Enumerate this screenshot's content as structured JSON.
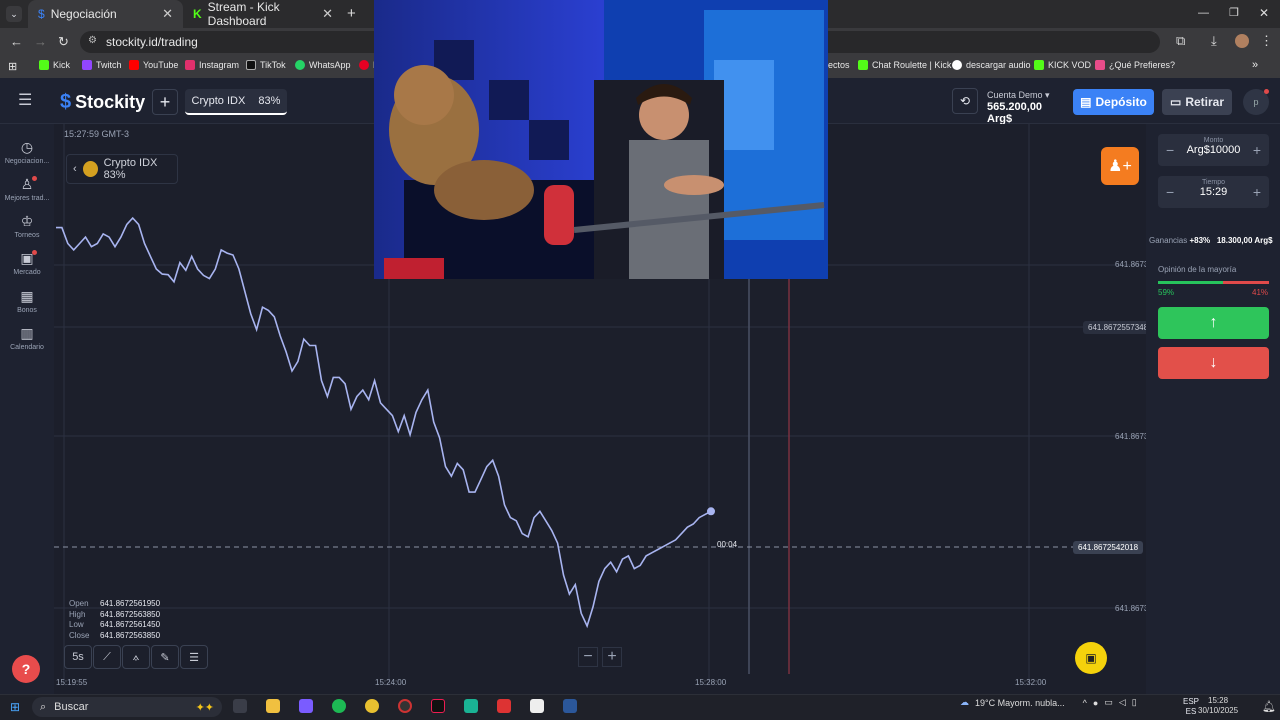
{
  "browser": {
    "tabs": [
      {
        "label": "Negociación"
      },
      {
        "label": "Stream - Kick Dashboard"
      }
    ],
    "url": "stockity.id/trading",
    "bookmarks": [
      {
        "label": "Kick",
        "color": "#53fc18"
      },
      {
        "label": "Twitch",
        "color": "#9146ff"
      },
      {
        "label": "YouTube",
        "color": "#ff0000"
      },
      {
        "label": "Instagram",
        "color": "#e1306c"
      },
      {
        "label": "TikTok",
        "color": "#111111"
      },
      {
        "label": "WhatsApp",
        "color": "#25d366"
      },
      {
        "label": "P",
        "color": "#e60023"
      },
      {
        "label": "ectos",
        "color": "#3a3a3d"
      },
      {
        "label": "Chat Roulette | Kick",
        "color": "#53fc18"
      },
      {
        "label": "descargar audio",
        "color": "#ffffff"
      },
      {
        "label": "KICK VOD",
        "color": "#53fc18"
      },
      {
        "label": "¿Qué Prefieres?",
        "color": "#e84c8a"
      }
    ]
  },
  "app": {
    "brand": "Stockity",
    "asset_tab": {
      "name": "Crypto IDX",
      "payout": "83%"
    },
    "account": {
      "type": "Cuenta Demo",
      "balance": "565.200,00 Arg$"
    },
    "deposit_label": "Depósito",
    "withdraw_label": "Retirar",
    "avatar_letter": "p"
  },
  "sidebar": [
    {
      "label": "Negociacion...",
      "icon": "clock-icon"
    },
    {
      "label": "Mejores trad...",
      "icon": "trophy-user-icon"
    },
    {
      "label": "Torneos",
      "icon": "cup-icon"
    },
    {
      "label": "Mercado",
      "icon": "bag-icon"
    },
    {
      "label": "Bonos",
      "icon": "gift-icon"
    },
    {
      "label": "Calendario",
      "icon": "calendar-icon"
    }
  ],
  "chart": {
    "timestamp": "15:27:59 GMT-3",
    "asset_pill": "Crypto IDX 83%",
    "ohlc": {
      "Open": "641.8672561950",
      "High": "641.8672563850",
      "Low": "641.8672561450",
      "Close": "641.8672563850"
    },
    "timeframe": "5s",
    "price_labels": [
      "641.8673",
      "641.8673",
      "641.8673"
    ],
    "hover_price": "641.8672557348",
    "current_price": "641.8672542018",
    "countdown": "00:04",
    "time_labels": [
      "15:19:55",
      "15:24:00",
      "15:28:00",
      "15:32:00"
    ]
  },
  "chart_data": {
    "type": "line",
    "series": [
      {
        "values": [
          641.86725715,
          641.86725715,
          641.8672569,
          641.8672568,
          641.8672569,
          641.867257,
          641.86725685,
          641.8672569,
          641.86725705,
          641.867257,
          641.86725685,
          641.867257,
          641.8672572,
          641.8672573,
          641.8672572,
          641.8672569,
          641.8672567,
          641.8672565,
          641.86725642,
          641.86725641,
          641.8672563,
          641.8672566,
          641.86725648,
          641.8672567,
          641.8672565,
          641.8672564,
          641.86725635,
          641.8672565,
          641.8672568,
          641.86725675,
          641.86725672,
          641.8672565,
          641.86725615,
          641.8672558,
          641.86725555,
          641.8672559,
          641.86725585,
          641.86725575,
          641.86725545,
          641.8672552,
          641.8672549,
          641.86725505,
          641.8672554,
          641.8672553,
          641.8672553,
          641.86725475,
          641.8672545,
          641.8672548,
          641.8672548,
          641.8672547,
          641.8672543,
          641.8672545,
          641.8672546,
          641.86725445,
          641.86725475,
          641.8672544,
          641.8672543,
          641.8672542,
          641.86725395,
          641.8672542,
          641.8672539,
          641.86725425,
          641.86725445,
          641.8672546,
          641.8672541,
          641.86725385,
          641.8672534,
          641.86725325,
          641.86725345,
          641.86725335,
          641.867253,
          641.867253,
          641.8672532,
          641.8672534,
          641.8672535,
          641.86725325,
          641.8672528,
          641.8672526,
          641.86725255,
          641.86725235,
          641.8672523,
          641.8672526,
          641.8672527,
          641.86725255,
          641.8672524,
          641.8672522,
          641.8672517,
          641.8672514,
          641.86725155,
          641.8672511,
          641.8672509,
          641.8672512,
          641.8672516,
          641.8672518,
          641.8672519,
          641.86725175,
          641.86725195,
          641.867252,
          641.8672518,
          641.86725185,
          641.867252,
          641.86725205,
          641.8672521,
          641.86725215,
          641.8672522,
          641.86725225,
          641.86725235,
          641.86725245,
          641.8672525,
          641.8672526,
          641.86725265,
          641.8672527
        ]
      }
    ],
    "xlabel": "",
    "ylabel": ""
  },
  "panel": {
    "amount_label": "Monto",
    "amount": "Arg$10000",
    "time_label": "Tiempo",
    "time": "15:29",
    "earnings_label": "Ganancias",
    "earnings_pct": "+83%",
    "earnings_value": "18.300,00 Arg$",
    "opinion_label": "Opinión de la mayoría",
    "opinion_up": 59,
    "opinion_up_text": "59%",
    "opinion_down_text": "41%"
  },
  "taskbar": {
    "search": "Buscar",
    "weather": "19°C  Mayorm. nubla...",
    "lang1": "ESP",
    "lang2": "ES",
    "time": "15:28",
    "date": "30/10/2025"
  }
}
